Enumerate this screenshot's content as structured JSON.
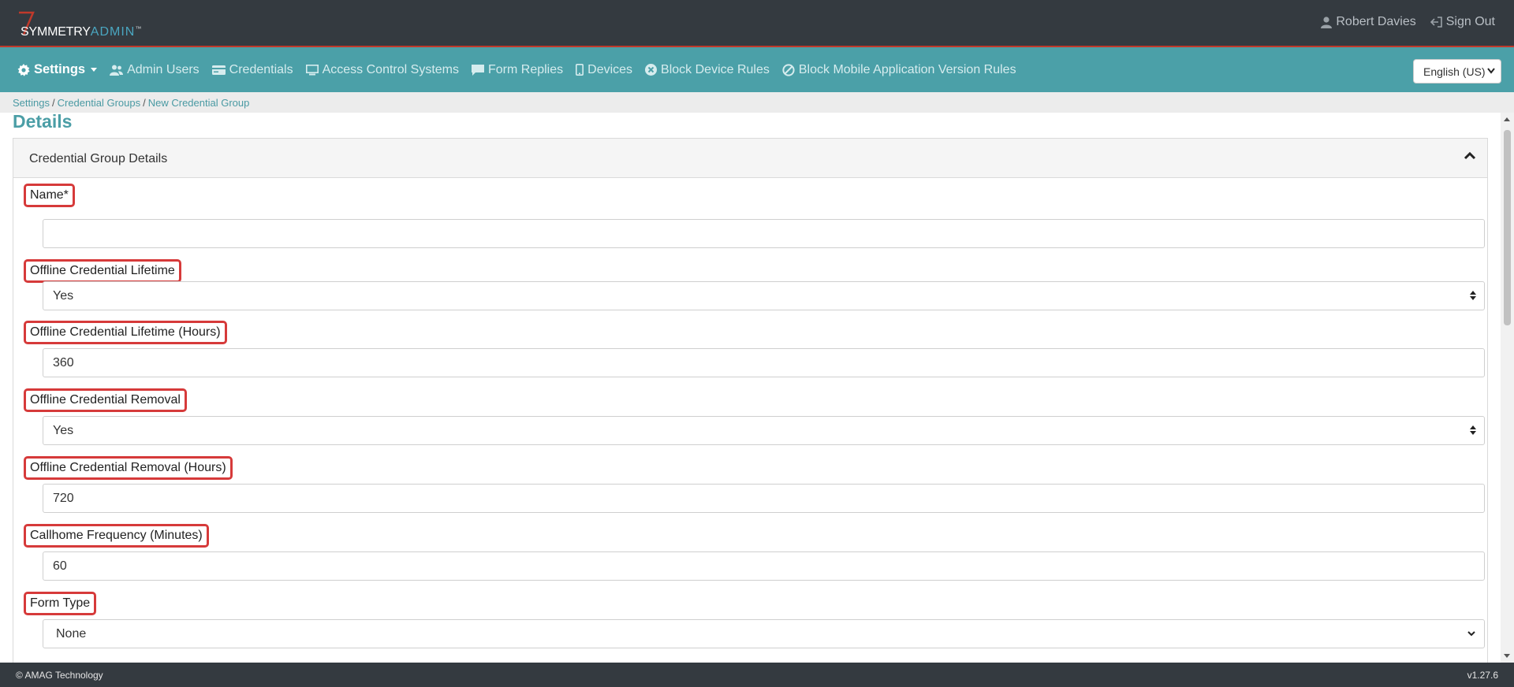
{
  "app": {
    "brand_part1": "SYMMETRY",
    "brand_part2": "ADMIN",
    "trademark": "™"
  },
  "user": {
    "name": "Robert Davies",
    "sign_out": "Sign Out",
    "user_icon": "user-icon",
    "sign_out_icon": "sign-out-icon"
  },
  "nav": {
    "settings": "Settings",
    "items": [
      {
        "label": "Admin Users",
        "icon": "users-icon"
      },
      {
        "label": "Credentials",
        "icon": "credential-card-icon"
      },
      {
        "label": "Access Control Systems",
        "icon": "monitor-icon"
      },
      {
        "label": "Form Replies",
        "icon": "comment-icon"
      },
      {
        "label": "Devices",
        "icon": "mobile-icon"
      },
      {
        "label": "Block Device Rules",
        "icon": "block-circle-x-icon"
      },
      {
        "label": "Block Mobile Application Version Rules",
        "icon": "ban-icon"
      }
    ],
    "language": "English (US)"
  },
  "breadcrumb": {
    "items": [
      "Settings",
      "Credential Groups",
      "New Credential Group"
    ],
    "separator": "/"
  },
  "page": {
    "title": "Details"
  },
  "card": {
    "title": "Credential Group Details",
    "fields": {
      "name": {
        "label": "Name*",
        "value": ""
      },
      "offline_lifetime": {
        "label": "Offline Credential Lifetime",
        "value": "Yes"
      },
      "offline_lifetime_hours": {
        "label": "Offline Credential Lifetime (Hours)",
        "value": "360"
      },
      "offline_removal": {
        "label": "Offline Credential Removal",
        "value": "Yes"
      },
      "offline_removal_hours": {
        "label": "Offline Credential Removal (Hours)",
        "value": "720"
      },
      "callhome": {
        "label": "Callhome Frequency (Minutes)",
        "value": "60"
      },
      "form_type": {
        "label": "Form Type",
        "value": "None"
      }
    }
  },
  "footer": {
    "copyright": "© AMAG Technology",
    "version": "v1.27.6"
  },
  "colors": {
    "topbar": "#343a40",
    "navbar": "#4ba0a8",
    "accent": "#4b9ea6",
    "highlight": "#d63a3a"
  }
}
